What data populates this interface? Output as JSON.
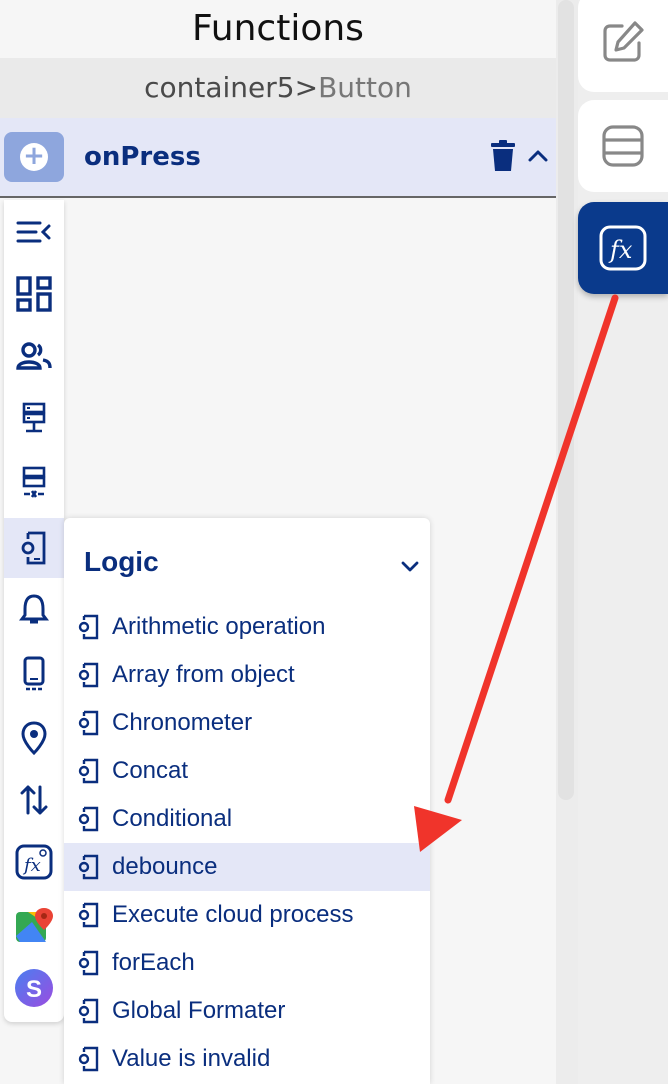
{
  "header": {
    "title": "Functions"
  },
  "breadcrumb": {
    "parent": "container5",
    "separator": ">",
    "current": "Button"
  },
  "event": {
    "name": "onPress"
  },
  "side_tabs": [
    {
      "icon": "edit-icon",
      "active": false
    },
    {
      "icon": "database-icon",
      "active": false
    },
    {
      "icon": "function-fx-icon",
      "active": true
    }
  ],
  "rail_icons": [
    "collapse-menu-icon",
    "dashboard-icon",
    "users-icon",
    "server-icon",
    "server-error-icon",
    "logic-device-icon",
    "bell-icon",
    "phone-icon",
    "location-pin-icon",
    "transfer-arrows-icon",
    "custom-function-icon",
    "google-maps-icon",
    "s-logo-icon"
  ],
  "logic": {
    "title": "Logic",
    "items": [
      "Arithmetic operation",
      "Array from object",
      "Chronometer",
      "Concat",
      "Conditional",
      "debounce",
      "Execute cloud process",
      "forEach",
      "Global Formater",
      "Value is invalid"
    ],
    "selected": "debounce"
  },
  "colors": {
    "primary": "#0a2e7e",
    "highlight": "#e4e7f7",
    "accent_tab": "#0a3a8c",
    "annotation_arrow": "#f0342b"
  }
}
